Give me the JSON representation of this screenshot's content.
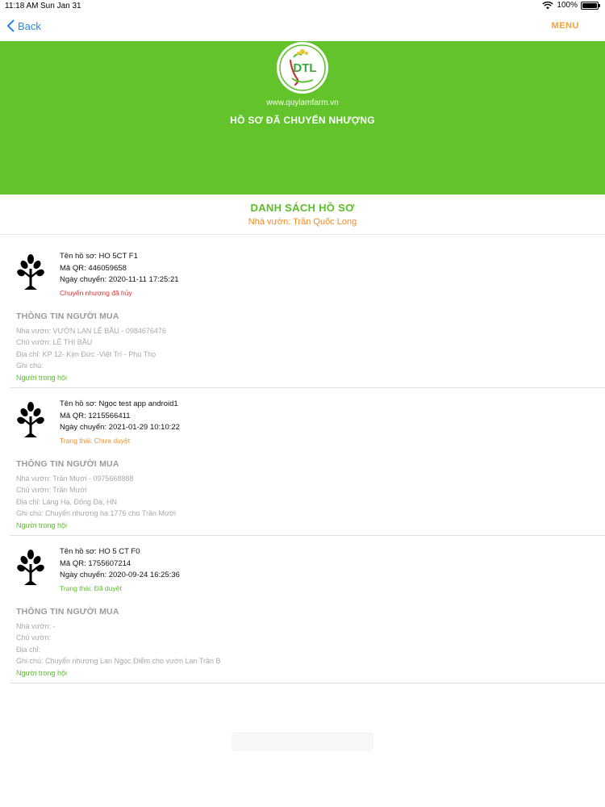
{
  "status_bar": {
    "time": "11:18 AM",
    "date": "Sun Jan 31",
    "battery": "100%"
  },
  "nav": {
    "back_label": "Back",
    "menu_label": "MENU"
  },
  "hero": {
    "logo_text": "DTL",
    "site_url": "www.quylamfarm.vn",
    "title": "HỒ SƠ ĐÃ CHUYỂN NHƯỢNG"
  },
  "list": {
    "title": "DANH SÁCH HỒ SƠ",
    "subtitle": "Nhà vườn: Trần Quốc Long"
  },
  "records": [
    {
      "name": "Tên hồ sơ: HO 5CT F1",
      "qr": "Mã QR: 446059658",
      "date": "Ngày chuyển: 2020-11-11 17:25:21",
      "status": "Chuyển nhượng đã hủy",
      "buyer_heading": "THÔNG TIN NGƯỜI MUA",
      "garden": "Nhà vườn:  VƯỜN LAN LỆ BẦU - 0984676476",
      "owner": "Chủ vườn: LÊ THỊ BẦU",
      "address": "Địa chỉ:  KP 12- Kim Đức -Việt Trì - Phú Thọ",
      "note": "Ghi chú:",
      "tag": "Người trong hội"
    },
    {
      "name": "Tên hồ sơ: Ngọc test app android1",
      "qr": "Mã QR: 1215566411",
      "date": "Ngày chuyển: 2021-01-29 10:10:22",
      "status": "Trạng thái: Chưa duyệt",
      "buyer_heading": "THÔNG TIN NGƯỜI MUA",
      "garden": "Nhà vườn: Trần Mười - 0975668888",
      "owner": "Chủ vườn: Trần Mười",
      "address": "Địa chỉ:  Láng Hạ, Đống Đa, HN",
      "note": "Ghi chú: Chuyển nhượng ha 1776 cho Trần Mười",
      "tag": "Người trong hội"
    },
    {
      "name": "Tên hồ sơ: HO 5 CT F0",
      "qr": "Mã QR: 1755607214",
      "date": "Ngày chuyển: 2020-09-24 16:25:36",
      "status": "Trạng thái: Đã duyệt",
      "buyer_heading": "THÔNG TIN NGƯỜI MUA",
      "garden": "Nhà vườn:  -",
      "owner": "Chủ vườn:",
      "address": "Địa chỉ:",
      "note": "Ghi chú: Chuyển nhượng Lan Ngọc Điểm cho vườn Lan Trần B",
      "tag": "Người trong hội"
    }
  ],
  "colors": {
    "hero_green": "#62c42a",
    "accent_orange": "#f28c28",
    "link_blue": "#2a86e0",
    "status_red": "#e03232"
  },
  "icons": [
    "chevron-left-icon",
    "wifi-icon",
    "battery-icon",
    "tree-icon"
  ]
}
